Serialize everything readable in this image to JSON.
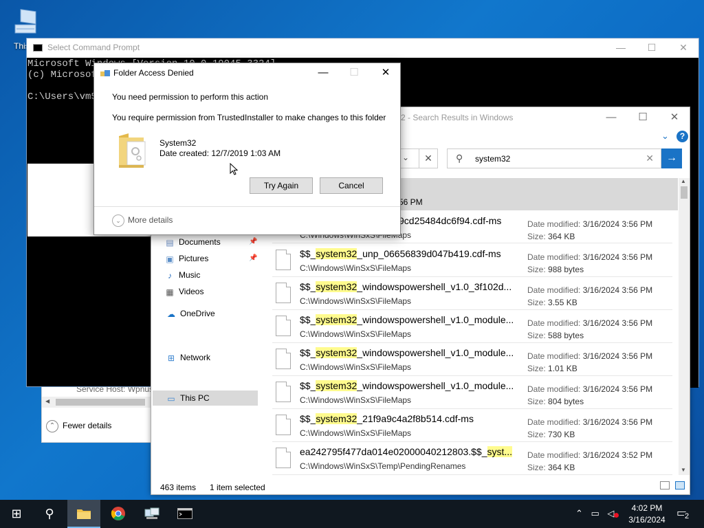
{
  "desktop": {
    "icon_label": "This"
  },
  "cmd": {
    "title": "Select Command Prompt",
    "lines": [
      "Microsoft Windows [Version 10.0.19045.3324]",
      "(c) Microsoft",
      "",
      "C:\\Users\\vm5"
    ],
    "min": "—",
    "max": "☐",
    "close": "✕"
  },
  "taskmgr": {
    "row_text": "Service Host: Wpnus",
    "fewer_details": "Fewer details",
    "fewer_icon": "⌃"
  },
  "explorer": {
    "title": "2 - Search Results in Windows",
    "min": "—",
    "max": "☐",
    "close": "✕",
    "help": "?",
    "expand_chevron": "⌄",
    "address_value": "",
    "clear_btn": "✕",
    "search": {
      "value": "system32",
      "clear": "✕",
      "go": "→"
    },
    "nav": [
      {
        "label": "Documents",
        "icon": "documents-icon",
        "glyph": "▤",
        "pinned": true
      },
      {
        "label": "Pictures",
        "icon": "pictures-icon",
        "glyph": "▣",
        "pinned": true
      },
      {
        "label": "Music",
        "icon": "music-icon",
        "glyph": "♪",
        "pinned": false
      },
      {
        "label": "Videos",
        "icon": "videos-icon",
        "glyph": "▦",
        "pinned": false
      },
      {
        "label": "OneDrive",
        "icon": "onedrive-icon",
        "glyph": "☁",
        "pinned": false
      },
      {
        "label": "This PC",
        "icon": "this-pc-icon",
        "glyph": "▭",
        "pinned": false,
        "selected": true
      },
      {
        "label": "Network",
        "icon": "network-icon",
        "glyph": "⊞",
        "pinned": false
      }
    ],
    "selected_row_date": "56 PM",
    "rows": [
      {
        "pre": "",
        "hl": "",
        "post": "9cd25484dc6f94.cdf-ms",
        "path": "C:\\Windows\\WinSxS\\FileMaps",
        "date": "3/16/2024 3:56 PM",
        "size": "364 KB"
      },
      {
        "pre": "$$_",
        "hl": "system32",
        "post": "_unp_06656839d047b419.cdf-ms",
        "path": "C:\\Windows\\WinSxS\\FileMaps",
        "date": "3/16/2024 3:56 PM",
        "size": "988 bytes"
      },
      {
        "pre": "$$_",
        "hl": "system32",
        "post": "_windowspowershell_v1.0_3f102d...",
        "path": "C:\\Windows\\WinSxS\\FileMaps",
        "date": "3/16/2024 3:56 PM",
        "size": "3.55 KB"
      },
      {
        "pre": "$$_",
        "hl": "system32",
        "post": "_windowspowershell_v1.0_module...",
        "path": "C:\\Windows\\WinSxS\\FileMaps",
        "date": "3/16/2024 3:56 PM",
        "size": "588 bytes"
      },
      {
        "pre": "$$_",
        "hl": "system32",
        "post": "_windowspowershell_v1.0_module...",
        "path": "C:\\Windows\\WinSxS\\FileMaps",
        "date": "3/16/2024 3:56 PM",
        "size": "1.01 KB"
      },
      {
        "pre": "$$_",
        "hl": "system32",
        "post": "_windowspowershell_v1.0_module...",
        "path": "C:\\Windows\\WinSxS\\FileMaps",
        "date": "3/16/2024 3:56 PM",
        "size": "804 bytes"
      },
      {
        "pre": "$$_",
        "hl": "system32",
        "post": "_21f9a9c4a2f8b514.cdf-ms",
        "path": "C:\\Windows\\WinSxS\\FileMaps",
        "date": "3/16/2024 3:56 PM",
        "size": "730 KB"
      },
      {
        "pre": "ea242795f477da014e02000040212803.$$_",
        "hl": "syst...",
        "post": "",
        "path": "C:\\Windows\\WinSxS\\Temp\\PendingRenames",
        "date": "3/16/2024 3:52 PM",
        "size": "364 KB"
      }
    ],
    "date_label": "Date modified:",
    "size_label": "Size:",
    "status": {
      "count": "463 items",
      "selected": "1 item selected"
    }
  },
  "dialog": {
    "title": "Folder Access Denied",
    "min": "—",
    "max": "☐",
    "close": "✕",
    "msg1": "You need permission to perform this action",
    "msg2": "You require permission from TrustedInstaller to make changes to this folder",
    "folder_name": "System32",
    "folder_date": "Date created: 12/7/2019 1:03 AM",
    "try_again": "Try Again",
    "cancel": "Cancel",
    "more_details": "More details",
    "more_icon": "⌄"
  },
  "taskbar": {
    "start": "⊞",
    "search": "⚲",
    "clock_time": "4:02 PM",
    "clock_date": "3/16/2024",
    "tray": "⌃ ▭ ◁",
    "notifications_count": "2"
  }
}
